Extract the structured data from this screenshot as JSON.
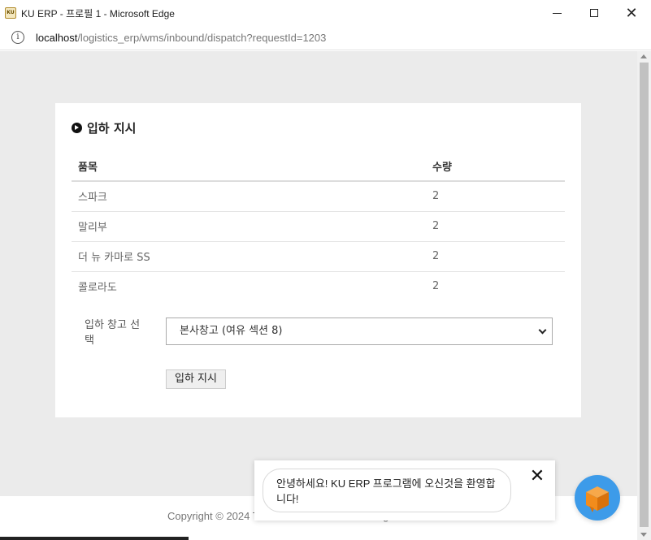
{
  "window": {
    "app_icon_text": "KU",
    "title": "KU ERP - 프로필 1 - Microsoft Edge"
  },
  "address": {
    "host": "localhost",
    "path": "/logistics_erp/wms/inbound/dispatch?requestId=1203"
  },
  "card": {
    "title": "입하 지시",
    "columns": [
      "품목",
      "수량"
    ],
    "rows": [
      {
        "name": "스파크",
        "qty": "2"
      },
      {
        "name": "말리부",
        "qty": "2"
      },
      {
        "name": "더 뉴 카마로 SS",
        "qty": "2"
      },
      {
        "name": "콜로라도",
        "qty": "2"
      }
    ],
    "warehouse_label": "입하 창고 선택",
    "warehouse_selected": "본사창고 (여유 섹션 8)",
    "dispatch_button": "입하 지시"
  },
  "footer": {
    "text": "Copyright © 2024 The Ultimate Cocktail. All Rights Reserved"
  },
  "toast": {
    "message": "안녕하세요! KU ERP 프로그램에 오신것을 환영합니다!",
    "close_symbol": "✕"
  },
  "colors": {
    "page_bg": "#ebebeb",
    "chat_fab": "#3d9be9",
    "chat_icon": "#f28c1c"
  }
}
